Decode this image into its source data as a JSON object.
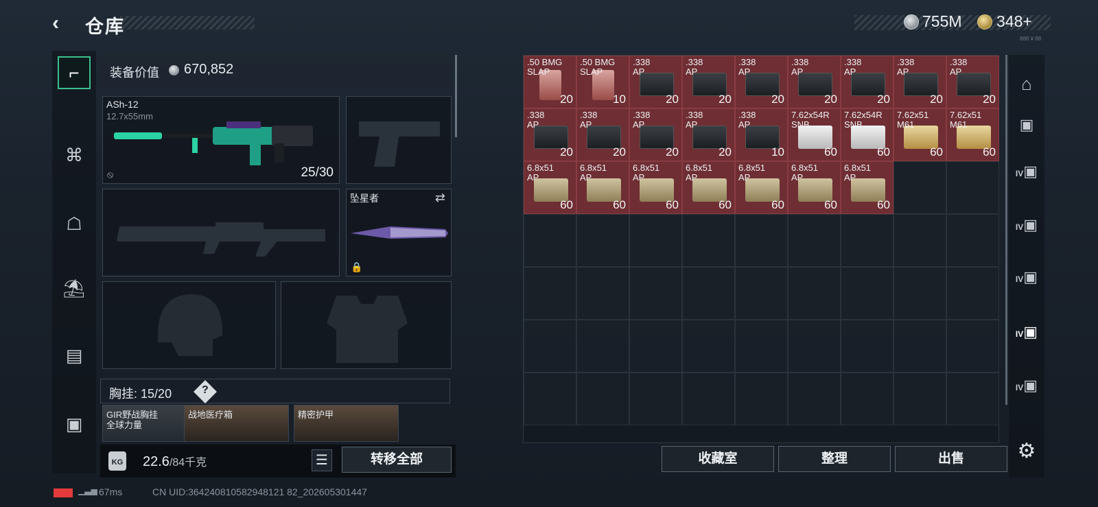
{
  "header": {
    "title": "仓库",
    "money": "755M",
    "coins": "348",
    "coins_plus": "+",
    "version": "888 ¥ 88"
  },
  "equipment": {
    "value_label": "装备价值",
    "value": "670,852",
    "primary": {
      "name": "ASh-12",
      "caliber": "12.7x55mm",
      "ammo": "25/30"
    },
    "melee": {
      "name": "坠星者"
    },
    "chest": {
      "label": "胸挂:",
      "capacity": "15/20",
      "help": "?"
    },
    "chest_items": [
      {
        "label": "GIR野战胸挂",
        "sub": "全球力量"
      },
      {
        "label": "战地医疗箱",
        "sub": ""
      },
      {
        "label": "精密护甲",
        "sub": ""
      }
    ],
    "weight": {
      "current": "22.6",
      "max": "/84千克",
      "icon": "KG"
    },
    "transfer_all": "转移全部"
  },
  "stash": {
    "items": [
      {
        "name": ".50 BMG\nSLAP",
        "count": "20",
        "style": "red"
      },
      {
        "name": ".50 BMG\nSLAP",
        "count": "10",
        "style": "red"
      },
      {
        "name": ".338\nAP",
        "count": "20",
        "style": "black"
      },
      {
        "name": ".338\nAP",
        "count": "20",
        "style": "black"
      },
      {
        "name": ".338\nAP",
        "count": "20",
        "style": "black"
      },
      {
        "name": ".338\nAP",
        "count": "20",
        "style": "black"
      },
      {
        "name": ".338\nAP",
        "count": "20",
        "style": "black"
      },
      {
        "name": ".338\nAP",
        "count": "20",
        "style": "black"
      },
      {
        "name": ".338\nAP",
        "count": "20",
        "style": "black"
      },
      {
        "name": ".338\nAP",
        "count": "20",
        "style": "black"
      },
      {
        "name": ".338\nAP",
        "count": "20",
        "style": "black"
      },
      {
        "name": ".338\nAP",
        "count": "20",
        "style": "black"
      },
      {
        "name": ".338\nAP",
        "count": "20",
        "style": "black"
      },
      {
        "name": ".338\nAP",
        "count": "10",
        "style": "black"
      },
      {
        "name": "7.62x54R\nSNB",
        "count": "60",
        "style": "white"
      },
      {
        "name": "7.62x54R\nSNB",
        "count": "60",
        "style": "white"
      },
      {
        "name": "7.62x51\nM61",
        "count": "60",
        "style": "gold"
      },
      {
        "name": "7.62x51\nM61",
        "count": "60",
        "style": "gold"
      },
      {
        "name": "6.8x51\nAP",
        "count": "60",
        "style": "tan"
      },
      {
        "name": "6.8x51\nAP",
        "count": "60",
        "style": "tan"
      },
      {
        "name": "6.8x51\nAP",
        "count": "60",
        "style": "tan"
      },
      {
        "name": "6.8x51\nAP",
        "count": "60",
        "style": "tan"
      },
      {
        "name": "6.8x51\nAP",
        "count": "60",
        "style": "tan"
      },
      {
        "name": "6.8x51\nAP",
        "count": "60",
        "style": "tan"
      },
      {
        "name": "6.8x51\nAP",
        "count": "60",
        "style": "tan"
      }
    ],
    "buttons": {
      "collection": "收藏室",
      "sort": "整理",
      "sell": "出售"
    }
  },
  "right_tabs": [
    {
      "icon": "vault-icon",
      "label": ""
    },
    {
      "icon": "case-icon",
      "label": ""
    },
    {
      "icon": "case-icon",
      "label": "IV"
    },
    {
      "icon": "case-icon",
      "label": "IV"
    },
    {
      "icon": "case-icon",
      "label": "IV"
    },
    {
      "icon": "case-icon",
      "label": "IV"
    },
    {
      "icon": "case-icon",
      "label": "IV"
    }
  ],
  "status": {
    "ping": "67ms",
    "uid": "CN UID:364240810582948121 82_202605301447"
  },
  "colors": {
    "accent_green": "#3bbf8d",
    "item_red": "#6e2e33",
    "battery_red": "#e23b3b"
  }
}
